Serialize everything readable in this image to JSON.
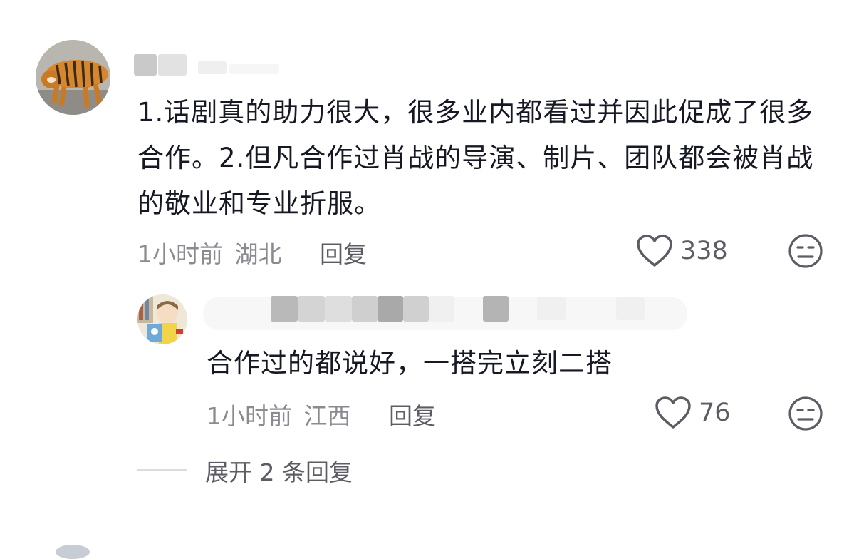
{
  "comment": {
    "avatar_icon": "tiger-avatar-icon",
    "text": "1.话剧真的助力很大，很多业内都看过并因此促成了很多合作。2.但凡合作过肖战的导演、制片、团队都会被肖战的敬业和专业折服。",
    "time": "1小时前",
    "location": "湖北",
    "reply_label": "回复",
    "like_count": "338",
    "like_icon": "heart-outline-icon",
    "dislike_icon": "unhappy-face-icon"
  },
  "reply": {
    "avatar_icon": "cartoon-avatar-icon",
    "text": "合作过的都说好，一搭完立刻二搭",
    "time": "1小时前",
    "location": "江西",
    "reply_label": "回复",
    "like_count": "76",
    "like_icon": "heart-outline-icon",
    "dislike_icon": "unhappy-face-icon"
  },
  "expand": {
    "label": "展开 2 条回复"
  }
}
